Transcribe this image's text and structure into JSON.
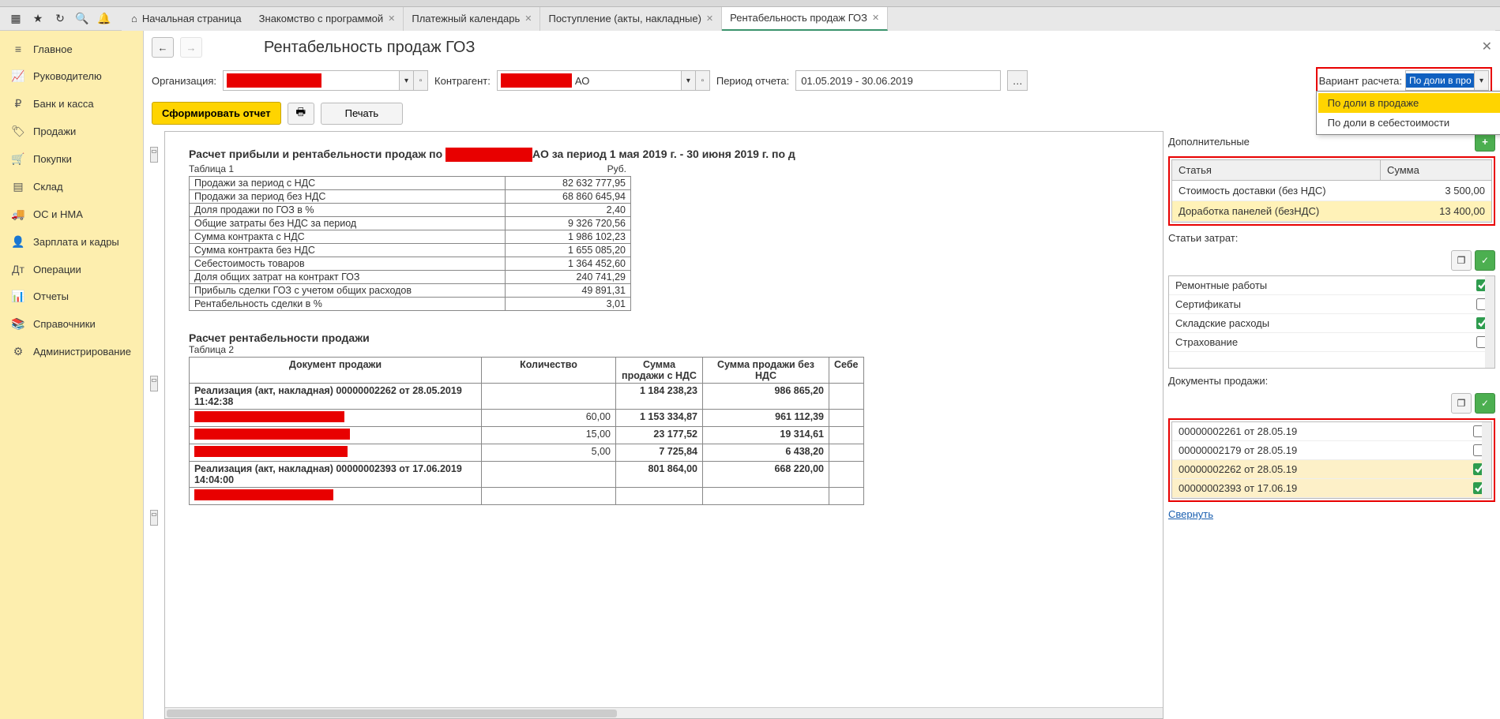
{
  "toolbar_icons": [
    "▦",
    "★",
    "↻",
    "🔍",
    "🔔"
  ],
  "tabs": {
    "home": "Начальная страница",
    "items": [
      {
        "label": "Знакомство с программой"
      },
      {
        "label": "Платежный календарь"
      },
      {
        "label": "Поступление (акты, накладные)"
      },
      {
        "label": "Рентабельность продаж ГОЗ",
        "active": true
      }
    ]
  },
  "sidebar": [
    {
      "icon": "≡",
      "label": "Главное"
    },
    {
      "icon": "📈",
      "label": "Руководителю"
    },
    {
      "icon": "₽",
      "label": "Банк и касса"
    },
    {
      "icon": "🏷",
      "label": "Продажи"
    },
    {
      "icon": "🛒",
      "label": "Покупки"
    },
    {
      "icon": "▤",
      "label": "Склад"
    },
    {
      "icon": "🚚",
      "label": "ОС и НМА"
    },
    {
      "icon": "👤",
      "label": "Зарплата и кадры"
    },
    {
      "icon": "Дт",
      "label": "Операции"
    },
    {
      "icon": "📊",
      "label": "Отчеты"
    },
    {
      "icon": "📚",
      "label": "Справочники"
    },
    {
      "icon": "⚙",
      "label": "Администрирование"
    }
  ],
  "page_title": "Рентабельность продаж ГОЗ",
  "filters": {
    "org_label": "Организация:",
    "contr_label": "Контрагент:",
    "contr_suffix": "АО",
    "period_label": "Период отчета:",
    "period_value": "01.05.2019 - 30.06.2019",
    "variant_label": "Вариант расчета:",
    "variant_value": "По доли в про"
  },
  "dropdown": {
    "opt1": "По доли в продаже",
    "opt2": "По доли в себестоимости"
  },
  "actions": {
    "form": "Сформировать отчет",
    "print": "Печать"
  },
  "report": {
    "title_prefix": "Расчет прибыли и рентабельности продаж по ",
    "title_suffix": "АО за период 1 мая 2019 г. - 30 июня 2019 г. по д",
    "table1_label": "Таблица 1",
    "rub": "Руб.",
    "rows": [
      {
        "l": "Продажи за период с НДС",
        "v": "82 632 777,95"
      },
      {
        "l": "Продажи за период без НДС",
        "v": "68 860 645,94"
      },
      {
        "l": "Доля продажи по ГОЗ в %",
        "v": "2,40"
      },
      {
        "l": "Общие затраты без НДС за период",
        "v": "9 326 720,56"
      },
      {
        "l": "Сумма контракта с НДС",
        "v": "1 986 102,23"
      },
      {
        "l": "Сумма контракта без НДС",
        "v": "1 655 085,20"
      },
      {
        "l": "Себестоимость товаров",
        "v": "1 364 452,60"
      },
      {
        "l": "Доля общих затрат на контракт ГОЗ",
        "v": "240 741,29"
      },
      {
        "l": "Прибыль сделки ГОЗ с учетом общих расходов",
        "v": "49 891,31"
      },
      {
        "l": "Рентабельность сделки в %",
        "v": "3,01"
      }
    ],
    "title2": "Расчет рентабельности продажи",
    "table2_label": "Таблица 2",
    "t2_headers": {
      "doc": "Документ продажи",
      "qty": "Количество",
      "sum_vat": "Сумма продажи с НДС",
      "sum_novat": "Сумма продажи без НДС",
      "cost": "Себе"
    },
    "t2_rows": [
      {
        "doc": "Реализация (акт, накладная) 00000002262 от 28.05.2019 11:42:38",
        "qty": "",
        "sum_vat": "1 184 238,23",
        "sum_novat": "986 865,20"
      },
      {
        "red": true,
        "qty": "60,00",
        "sum_vat": "1 153 334,87",
        "sum_novat": "961 112,39"
      },
      {
        "red": true,
        "qty": "15,00",
        "sum_vat": "23 177,52",
        "sum_novat": "19 314,61"
      },
      {
        "red": true,
        "qty": "5,00",
        "sum_vat": "7 725,84",
        "sum_novat": "6 438,20"
      },
      {
        "doc": "Реализация (акт, накладная) 00000002393 от 17.06.2019 14:04:00",
        "qty": "",
        "sum_vat": "801 864,00",
        "sum_novat": "668 220,00"
      },
      {
        "red": true,
        "qty": "",
        "sum_vat": "",
        "sum_novat": ""
      }
    ]
  },
  "right": {
    "extra_label": "Дополнительные",
    "art_header": "Статья",
    "sum_header": "Сумма",
    "extra_rows": [
      {
        "l": "Стоимость доставки (без НДС)",
        "v": "3 500,00"
      },
      {
        "l": "Доработка панелей (безНДС)",
        "v": "13 400,00",
        "sel": true
      }
    ],
    "cost_label": "Статьи затрат:",
    "cost_items": [
      {
        "l": "Ремонтные работы",
        "c": true
      },
      {
        "l": "Сертификаты",
        "c": false
      },
      {
        "l": "Складские расходы",
        "c": true
      },
      {
        "l": "Страхование",
        "c": false
      }
    ],
    "docs_label": "Документы продажи:",
    "docs": [
      {
        "l": "00000002261 от 28.05.19",
        "c": false
      },
      {
        "l": "00000002179 от 28.05.19",
        "c": false
      },
      {
        "l": "00000002262 от 28.05.19",
        "c": true,
        "sel": true
      },
      {
        "l": "00000002393 от 17.06.19",
        "c": true,
        "sel": true
      }
    ],
    "collapse": "Свернуть"
  }
}
